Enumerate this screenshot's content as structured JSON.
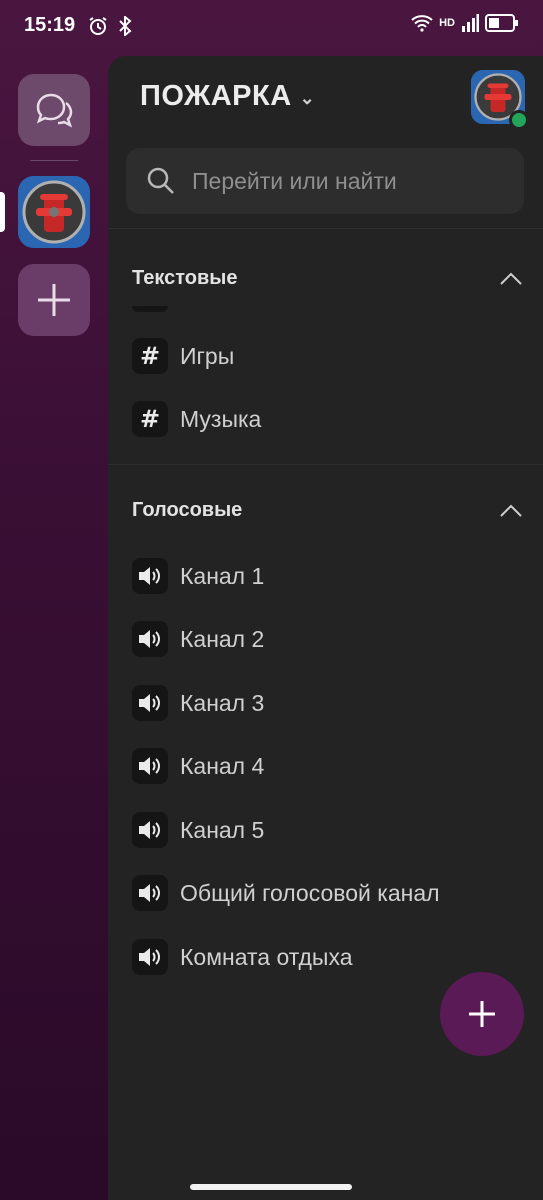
{
  "status_bar": {
    "time": "15:19",
    "network_label": "HD"
  },
  "server": {
    "name": "ПОЖАРКА"
  },
  "search": {
    "placeholder": "Перейти или найти"
  },
  "sections": {
    "text": {
      "title": "Текстовые",
      "channels": [
        {
          "label": "Игры",
          "icon": "hash-icon"
        },
        {
          "label": "Музыка",
          "icon": "hash-icon"
        }
      ]
    },
    "voice": {
      "title": "Голосовые",
      "channels": [
        {
          "label": "Канал 1",
          "icon": "speaker-icon"
        },
        {
          "label": "Канал 2",
          "icon": "speaker-icon"
        },
        {
          "label": "Канал 3",
          "icon": "speaker-icon"
        },
        {
          "label": "Канал 4",
          "icon": "speaker-icon"
        },
        {
          "label": "Канал 5",
          "icon": "speaker-icon"
        },
        {
          "label": "Общий голосовой канал",
          "icon": "speaker-icon"
        },
        {
          "label": "Комната отдыха",
          "icon": "speaker-icon"
        }
      ]
    }
  },
  "colors": {
    "accent": "#5a1a55",
    "online": "#23a55a",
    "panel": "#232323"
  }
}
